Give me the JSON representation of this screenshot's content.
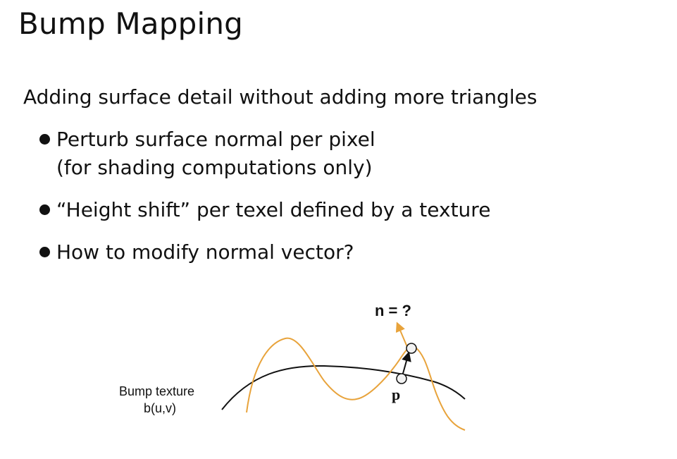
{
  "slide": {
    "title": "Bump Mapping",
    "intro": "Adding surface detail without adding more triangles",
    "bullets": [
      {
        "lines": [
          "Perturb surface normal per pixel",
          "(for shading computations only)"
        ]
      },
      {
        "lines": [
          "“Height shift” per texel defined by a texture"
        ]
      },
      {
        "lines": [
          "How to modify normal vector?"
        ]
      }
    ]
  },
  "diagram": {
    "normal_label": "n = ?",
    "texture_label_line1": "Bump texture",
    "texture_label_line2": "b(u,v)",
    "point_label": "p",
    "colors": {
      "surface": "#111111",
      "bump": "#E8A33B",
      "point_fill": "#F2F2F2"
    }
  }
}
